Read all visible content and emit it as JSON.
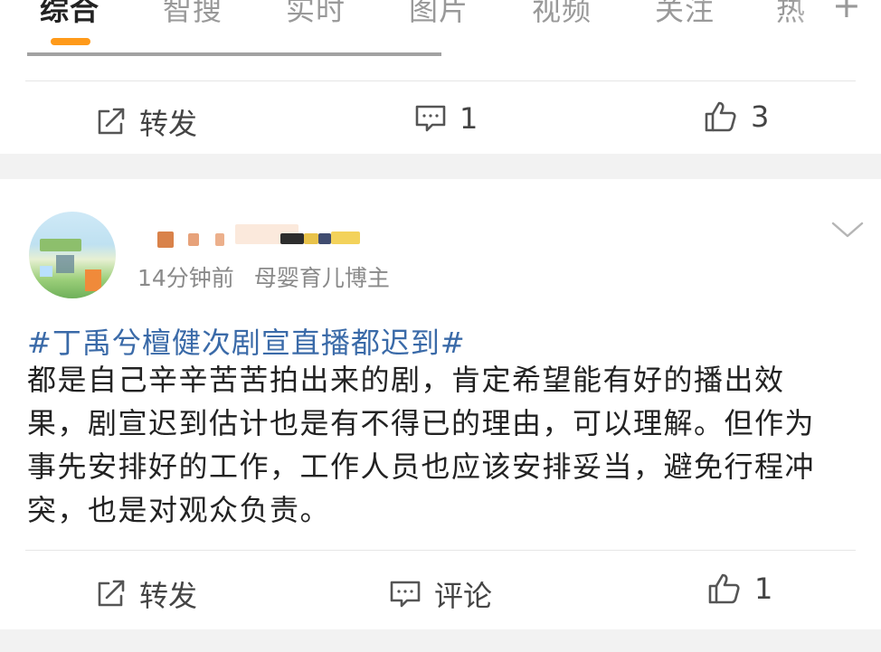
{
  "tabs": {
    "items": [
      "综合",
      "智搜",
      "实时",
      "图片",
      "视频",
      "关注",
      "热"
    ],
    "active_index": 0,
    "add_label": "+"
  },
  "previous_post": {
    "repost_label": "转发",
    "comment_count": "1",
    "like_count": "3"
  },
  "post": {
    "author_name": "",
    "time": "14分钟前",
    "author_tag": "母婴育儿博主",
    "topic": "#丁禹兮檀健次剧宣直播都迟到#",
    "body_lines": [
      "都是自己辛辛苦苦拍出来的剧，肯定希望能有好的播出效",
      "果，剧宣迟到估计也是有不得已的理由，可以理解。但作为",
      "事先安排好的工作，工作人员也应该安排妥当，避免行程冲",
      "突，也是对观众负责。"
    ],
    "repost_label": "转发",
    "comment_label": "评论",
    "like_count": "1"
  },
  "colors": {
    "accent": "#ff9a1a",
    "topic_link": "#3a6aa8",
    "background": "#f2f2f2"
  },
  "icons": [
    "repost-icon",
    "comment-icon",
    "like-icon",
    "chevron-down-icon"
  ]
}
